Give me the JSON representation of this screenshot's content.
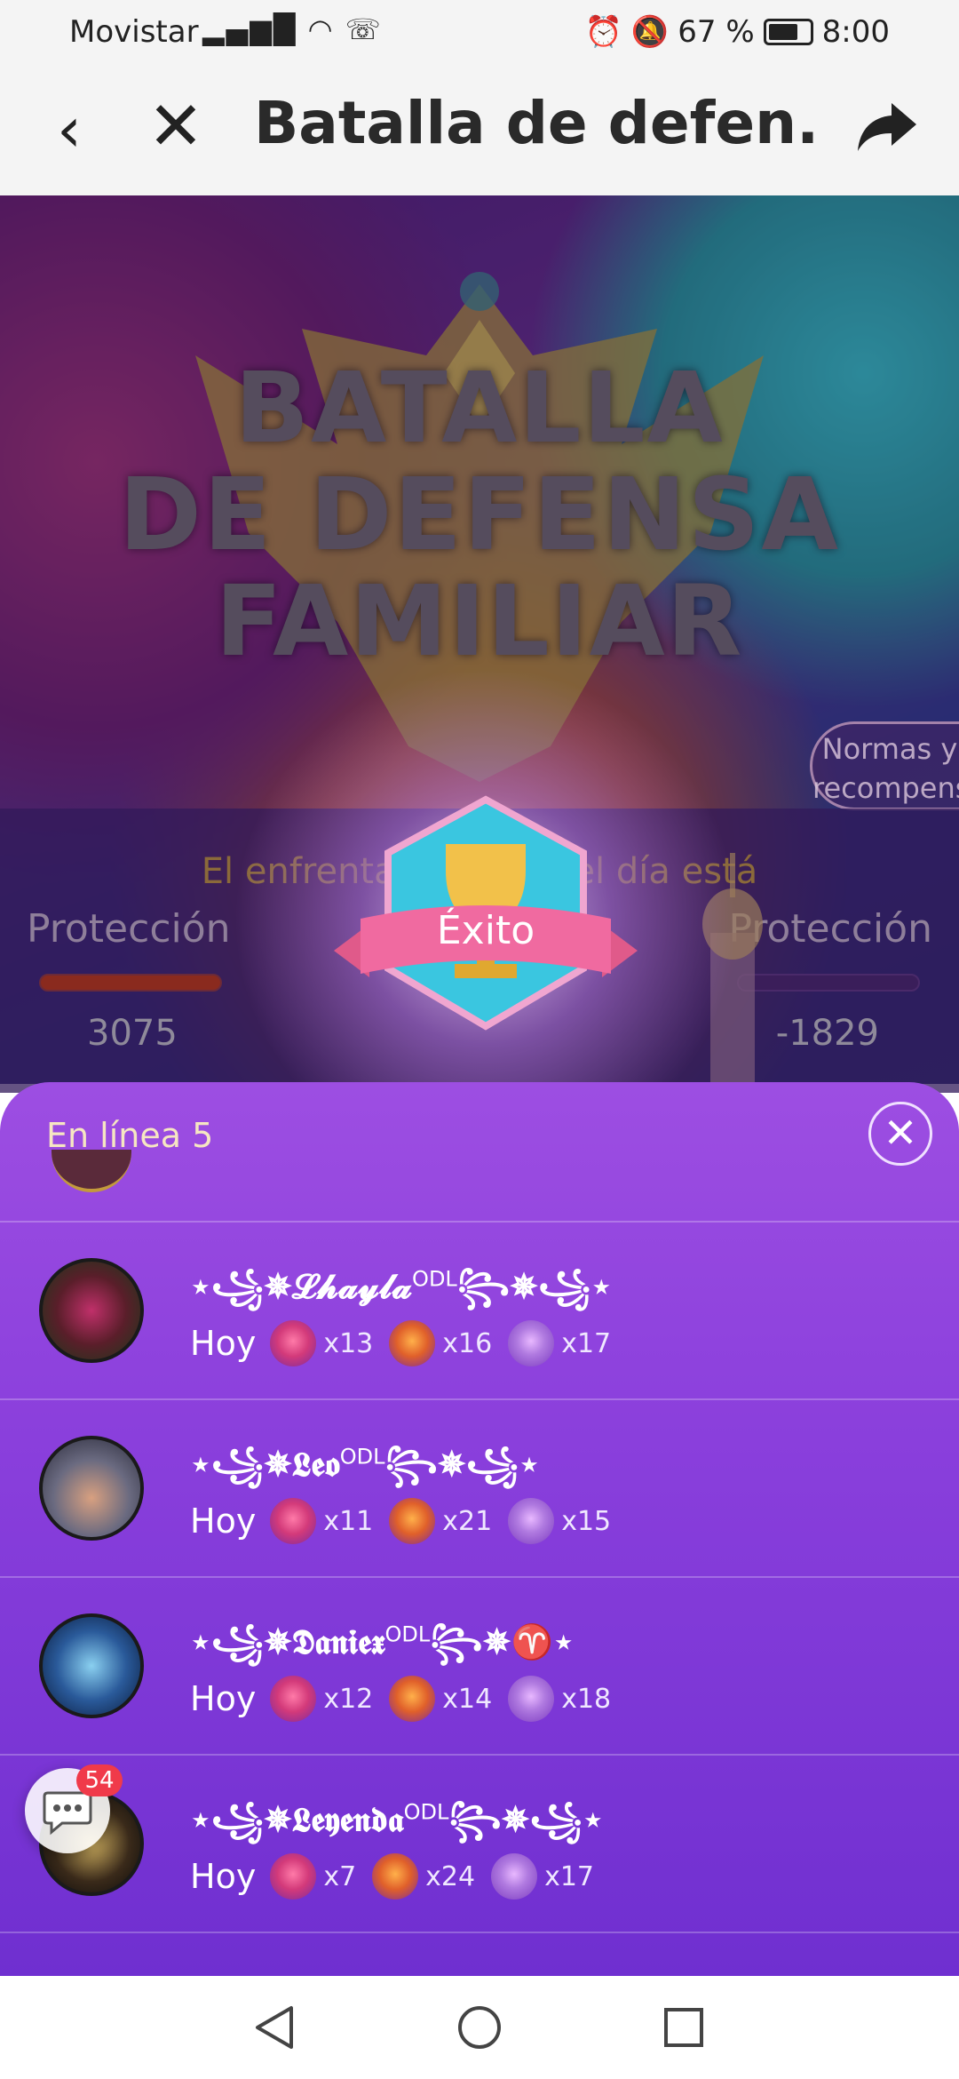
{
  "status_bar": {
    "carrier": "Movistar",
    "battery_pct": "67 %",
    "time": "8:00"
  },
  "header": {
    "title": "Batalla de defen..."
  },
  "banner": {
    "title_line1": "BATALLA",
    "title_line2": "DE DEFENSA",
    "title_line3": "FAMILIAR",
    "rules_line1": "Normas y",
    "rules_line2": "recompensa"
  },
  "battle": {
    "notice": "El enfrentamie        iliar del día está",
    "left_label": "Protección",
    "right_label": "Protección",
    "left_value": "3075",
    "right_value": "-1829"
  },
  "success_popup": {
    "label": "Éxito"
  },
  "sheet": {
    "online_label": "En línea 5",
    "members": [
      {
        "name": "⋆꧁✵𝓛𝓱𝓪𝔂𝓵𝓪",
        "name_sup": "ODL",
        "name_tail": "꧂✵꧁⋆",
        "day": "Hoy",
        "gifts": [
          "x13",
          "x16",
          "x17"
        ]
      },
      {
        "name": "⋆꧁✵𝕷𝖊𝖔",
        "name_sup": "ODL",
        "name_tail": "꧂✵꧁⋆",
        "day": "Hoy",
        "gifts": [
          "x11",
          "x21",
          "x15"
        ]
      },
      {
        "name": "⋆꧁✵𝕯𝖆𝖓𝖎𝖊𝖝",
        "name_sup": "ODL",
        "name_tail": "꧂✵♈⋆",
        "day": "Hoy",
        "gifts": [
          "x12",
          "x14",
          "x18"
        ]
      },
      {
        "name": "⋆꧁✵𝕷𝖊𝖞𝖊𝖓𝖉𝖆",
        "name_sup": "ODL",
        "name_tail": "꧂✵꧁⋆",
        "day": "Hoy",
        "gifts": [
          "x7",
          "x24",
          "x17"
        ]
      }
    ],
    "chat_badge": "54"
  }
}
